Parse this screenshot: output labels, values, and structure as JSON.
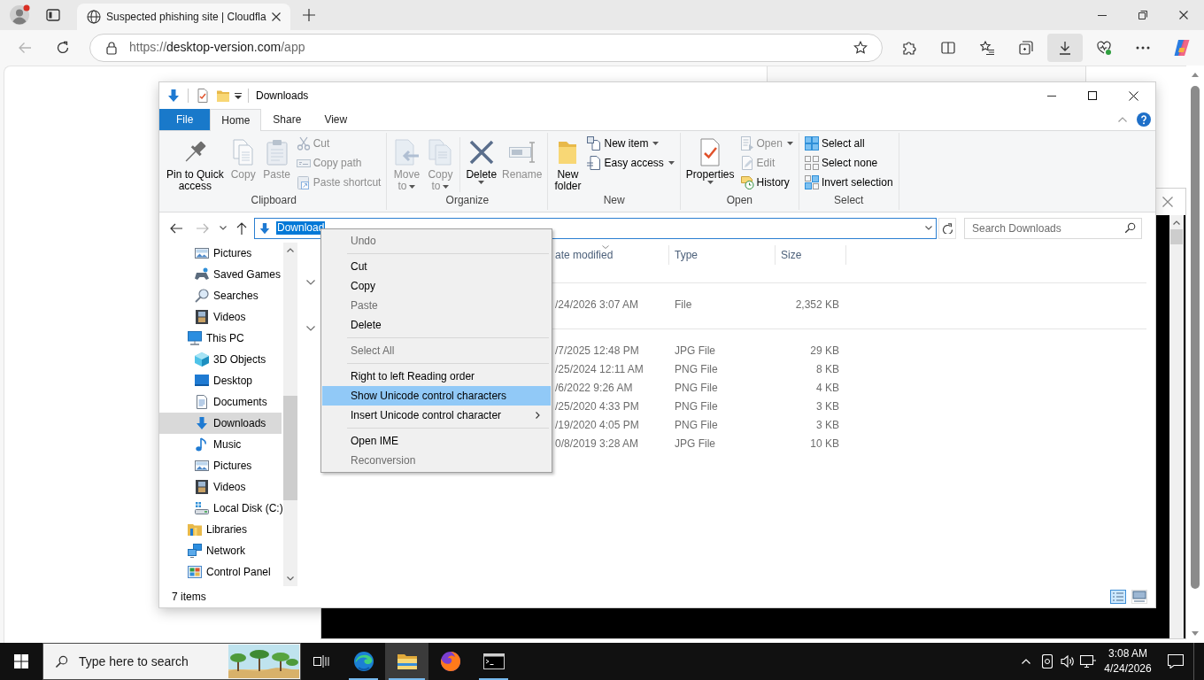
{
  "browser": {
    "tab_title": "Suspected phishing site | Cloudfla",
    "back_disabled": true,
    "url": {
      "scheme": "https://",
      "host": "desktop-version.com",
      "path": "/app"
    },
    "downloads_active": true
  },
  "explorer": {
    "title": "Downloads",
    "tabs": [
      {
        "label": "File",
        "kind": "file",
        "selected": false
      },
      {
        "label": "Home",
        "kind": "tab",
        "selected": true
      },
      {
        "label": "Share",
        "kind": "tab",
        "selected": false
      },
      {
        "label": "View",
        "kind": "tab",
        "selected": false
      }
    ],
    "ribbon": [
      {
        "label": "Clipboard",
        "buttons": [
          {
            "kind": "large",
            "label": "Pin to Quick access",
            "disabled": false,
            "dropdown": false
          },
          {
            "kind": "large",
            "label": "Copy",
            "disabled": true,
            "dropdown": false
          },
          {
            "kind": "large",
            "label": "Paste",
            "disabled": true,
            "dropdown": false
          },
          {
            "kind": "small",
            "label": "Cut",
            "disabled": true,
            "dropdown": false
          },
          {
            "kind": "small",
            "label": "Copy path",
            "disabled": true,
            "dropdown": false
          },
          {
            "kind": "small",
            "label": "Paste shortcut",
            "disabled": true,
            "dropdown": false
          }
        ]
      },
      {
        "label": "Organize",
        "buttons": [
          {
            "kind": "large",
            "label": "Move to",
            "disabled": true,
            "dropdown": true
          },
          {
            "kind": "large",
            "label": "Copy to",
            "disabled": true,
            "dropdown": true
          },
          {
            "kind": "separator"
          },
          {
            "kind": "large",
            "label": "Delete",
            "disabled": false,
            "dropdown": true
          },
          {
            "kind": "large",
            "label": "Rename",
            "disabled": true,
            "dropdown": false
          }
        ]
      },
      {
        "label": "New",
        "buttons": [
          {
            "kind": "large",
            "label": "New folder",
            "disabled": false,
            "dropdown": false
          },
          {
            "kind": "small",
            "label": "New item",
            "disabled": false,
            "dropdown": true
          },
          {
            "kind": "small",
            "label": "Easy access",
            "disabled": false,
            "dropdown": true
          }
        ]
      },
      {
        "label": "Open",
        "buttons": [
          {
            "kind": "large",
            "label": "Properties",
            "disabled": false,
            "dropdown": true
          },
          {
            "kind": "small",
            "label": "Open",
            "disabled": true,
            "dropdown": true
          },
          {
            "kind": "small",
            "label": "Edit",
            "disabled": true,
            "dropdown": false
          },
          {
            "kind": "small",
            "label": "History",
            "disabled": false,
            "dropdown": false
          }
        ]
      },
      {
        "label": "Select",
        "buttons": [
          {
            "kind": "small",
            "label": "Select all",
            "disabled": false,
            "dropdown": false
          },
          {
            "kind": "small",
            "label": "Select none",
            "disabled": false,
            "dropdown": false
          },
          {
            "kind": "small",
            "label": "Invert selection",
            "disabled": false,
            "dropdown": false
          }
        ]
      }
    ],
    "back_disabled": false,
    "forward_disabled": true,
    "address": {
      "text": "Download",
      "highlighted": true
    },
    "search": {
      "placeholder": "Search Downloads"
    },
    "nav": [
      {
        "children": [
          {
            "label": "Pictures",
            "kind": "pictures",
            "selected": false
          },
          {
            "label": "Saved Games",
            "kind": "saved_games",
            "selected": false
          },
          {
            "label": "Searches",
            "kind": "searches",
            "selected": false
          },
          {
            "label": "Videos",
            "kind": "videos",
            "selected": false
          }
        ]
      },
      {
        "label": "This PC",
        "kind": "pc",
        "selected": false,
        "children": [
          {
            "label": "3D Objects",
            "kind": "objects_3d",
            "selected": false
          },
          {
            "label": "Desktop",
            "kind": "desktop",
            "selected": false
          },
          {
            "label": "Documents",
            "kind": "documents",
            "selected": false
          },
          {
            "label": "Downloads",
            "kind": "downloads",
            "selected": true
          },
          {
            "label": "Music",
            "kind": "music",
            "selected": false
          },
          {
            "label": "Pictures",
            "kind": "pictures",
            "selected": false
          },
          {
            "label": "Videos",
            "kind": "videos",
            "selected": false
          },
          {
            "label": "Local Disk (C:)",
            "kind": "disk",
            "selected": false
          }
        ]
      },
      {
        "label": "Libraries",
        "kind": "libraries",
        "selected": false
      },
      {
        "label": "Network",
        "kind": "network",
        "selected": false
      },
      {
        "label": "Control Panel",
        "kind": "control_panel",
        "selected": false
      }
    ],
    "columns": [
      {
        "label": "ate modified",
        "sorted": true
      },
      {
        "label": "Type",
        "sorted": false
      },
      {
        "label": "Size",
        "sorted": false
      }
    ],
    "groups": [
      {
        "expanded": true,
        "rows": [
          {
            "date": "/24/2026 3:07 AM",
            "type": "File",
            "size": "2,352 KB"
          }
        ]
      },
      {
        "expanded": true,
        "rows": [
          {
            "date": "/7/2025 12:48 PM",
            "type": "JPG File",
            "size": "29 KB"
          },
          {
            "date": "/25/2024 12:11 AM",
            "type": "PNG File",
            "size": "8 KB"
          },
          {
            "date": "/6/2022 9:26 AM",
            "type": "PNG File",
            "size": "4 KB"
          },
          {
            "date": "/25/2020 4:33 PM",
            "type": "PNG File",
            "size": "3 KB"
          },
          {
            "date": "/19/2020 4:05 PM",
            "type": "PNG File",
            "size": "3 KB"
          },
          {
            "date": "0/8/2019 3:28 AM",
            "type": "JPG File",
            "size": "10 KB"
          }
        ]
      }
    ],
    "status": "7 items",
    "views": [
      {
        "kind": "details",
        "selected": true
      },
      {
        "kind": "large_icons",
        "selected": false
      }
    ]
  },
  "context_menu": [
    {
      "kind": "item",
      "label": "Undo",
      "disabled": true,
      "highlighted": false,
      "submenu": false
    },
    {
      "kind": "separator"
    },
    {
      "kind": "item",
      "label": "Cut",
      "disabled": false,
      "highlighted": false,
      "submenu": false
    },
    {
      "kind": "item",
      "label": "Copy",
      "disabled": false,
      "highlighted": false,
      "submenu": false
    },
    {
      "kind": "item",
      "label": "Paste",
      "disabled": true,
      "highlighted": false,
      "submenu": false
    },
    {
      "kind": "item",
      "label": "Delete",
      "disabled": false,
      "highlighted": false,
      "submenu": false
    },
    {
      "kind": "separator"
    },
    {
      "kind": "item",
      "label": "Select All",
      "disabled": true,
      "highlighted": false,
      "submenu": false
    },
    {
      "kind": "separator"
    },
    {
      "kind": "item",
      "label": "Right to left Reading order",
      "disabled": false,
      "highlighted": false,
      "submenu": false
    },
    {
      "kind": "item",
      "label": "Show Unicode control characters",
      "disabled": false,
      "highlighted": true,
      "submenu": false
    },
    {
      "kind": "item",
      "label": "Insert Unicode control character",
      "disabled": false,
      "highlighted": false,
      "submenu": true
    },
    {
      "kind": "separator"
    },
    {
      "kind": "item",
      "label": "Open IME",
      "disabled": false,
      "highlighted": false,
      "submenu": false
    },
    {
      "kind": "item",
      "label": "Reconversion",
      "disabled": true,
      "highlighted": false,
      "submenu": false
    }
  ],
  "taskbar": {
    "search": {
      "placeholder": "Type here to search"
    },
    "apps": [
      {
        "kind": "edge",
        "active": false,
        "running": true
      },
      {
        "kind": "explorer",
        "active": true,
        "running": true
      },
      {
        "kind": "firefox",
        "active": false,
        "running": false
      },
      {
        "kind": "terminal",
        "active": false,
        "running": true
      }
    ],
    "time": "3:08 AM",
    "date": "4/24/2026"
  }
}
